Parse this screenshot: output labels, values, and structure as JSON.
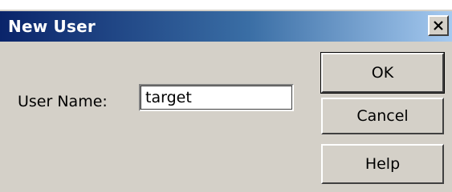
{
  "window": {
    "title": "New User",
    "close_glyph": "×"
  },
  "form": {
    "user_name_label": "User Name:",
    "user_name_value": "target"
  },
  "buttons": {
    "ok": "OK",
    "cancel": "Cancel",
    "help": "Help"
  },
  "colors": {
    "title_gradient_start": "#0a246a",
    "title_gradient_end": "#a6caf0",
    "dialog_face": "#d4d0c8"
  },
  "icons": {
    "close": "close-icon"
  }
}
